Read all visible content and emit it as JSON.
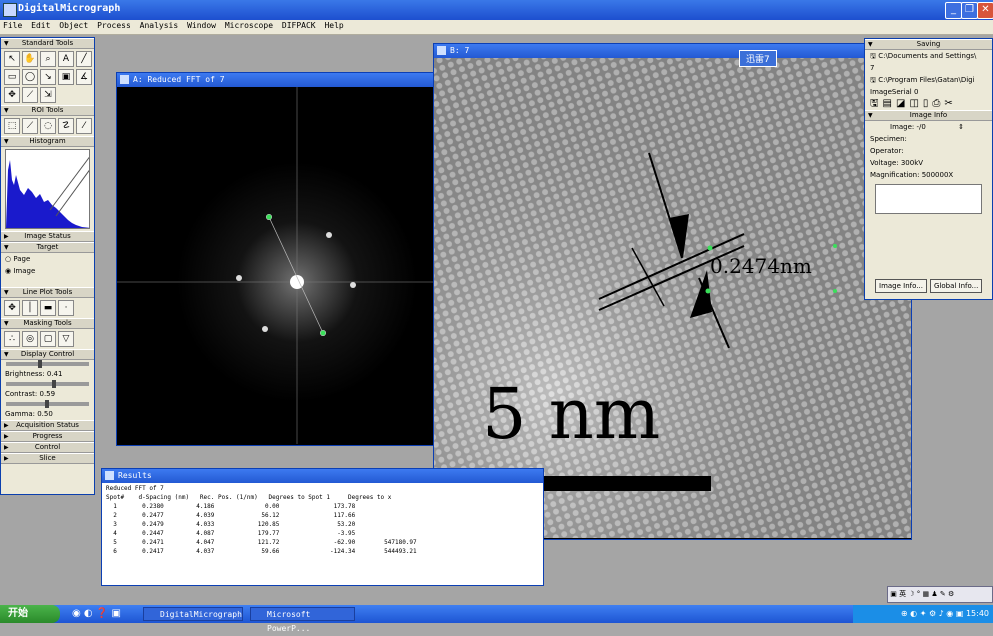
{
  "app": {
    "title": "DigitalMicrograph"
  },
  "menu": [
    "File",
    "Edit",
    "Object",
    "Process",
    "Analysis",
    "Window",
    "Microscope",
    "DIFPACK",
    "Help"
  ],
  "tools": {
    "standard": "Standard Tools",
    "roi": "ROI Tools",
    "histogram": "Histogram",
    "image_status": "Image Status",
    "target": "Target",
    "target_opt1": "Page",
    "target_opt2": "Image",
    "line_plot": "Line Plot Tools",
    "masking": "Masking Tools",
    "display_control": "Display Control",
    "brightness": "Brightness: 0.41",
    "contrast": "Contrast: 0.59",
    "gamma": "Gamma: 0.50",
    "acquisition": "Acquisition Status",
    "progress": "Progress",
    "control": "Control",
    "slice": "Slice"
  },
  "fft_window": {
    "title": "A: Reduced FFT of 7"
  },
  "image_window": {
    "title": "B: 7",
    "badge": "迅雷7",
    "measurement": "0.2474nm",
    "scalebar": "5 nm"
  },
  "results": {
    "title": "Results",
    "header": "Reduced FFT of 7",
    "columns": "Spot#    d-Spacing (nm)   Rec. Pos. (1/nm)   Degrees to Spot 1     Degrees to x",
    "rows": [
      "  1       0.2380         4.186              0.00               173.78",
      "  2       0.2477         4.039             56.12               117.66",
      "  3       0.2479         4.033            120.85                53.20",
      "  4       0.2447         4.087            179.77                -3.95",
      "  5       0.2471         4.047            121.72               -62.90        547180.97",
      "  6       0.2417         4.037             59.66              -124.34        544493.21"
    ]
  },
  "info_panel": {
    "saving": "Saving",
    "path1": "C:\\Documents and Settings\\",
    "path1b": "7",
    "path2": "C:\\Program Files\\Gatan\\Digi",
    "path2b": "ImageSerial 0",
    "image_info": "Image Info",
    "image_label": "Image: -/0",
    "specimen": "Specimen:",
    "operator": "Operator:",
    "voltage": "Voltage: 300kV",
    "magnification": "Magnification: 500000X",
    "btn_image_info": "Image Info...",
    "btn_global_info": "Global Info..."
  },
  "taskbar": {
    "start": "开始",
    "task1": "DigitalMicrograph",
    "task2": "Microsoft PowerP...",
    "time": "15:40"
  },
  "colors": {
    "title_blue": "#2359d3",
    "histogram": "#1a1acc",
    "fft_spot": "#3adf5a"
  }
}
